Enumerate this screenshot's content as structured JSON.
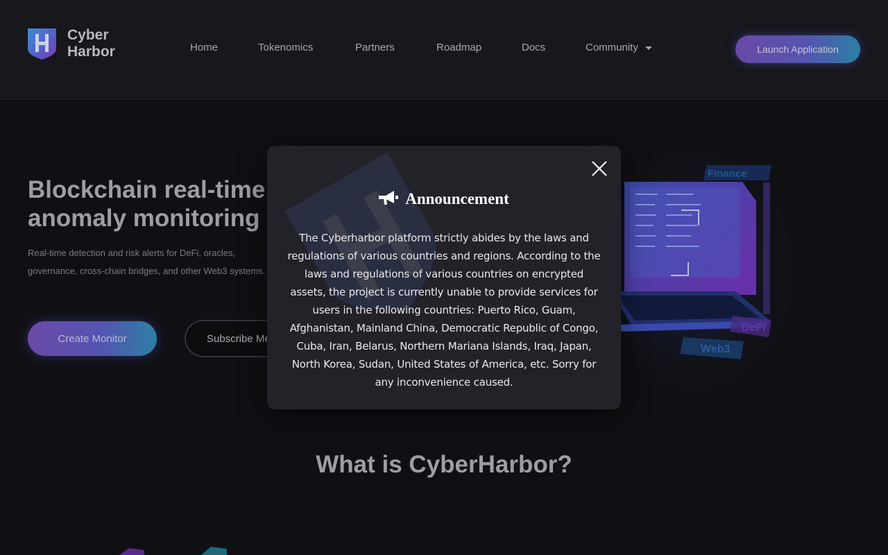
{
  "brand": {
    "name": "Cyber\nHarbor",
    "logo_letter": "H"
  },
  "nav": {
    "items": [
      {
        "label": "Home"
      },
      {
        "label": "Tokenomics"
      },
      {
        "label": "Partners"
      },
      {
        "label": "Roadmap"
      },
      {
        "label": "Docs"
      },
      {
        "label": "Community"
      }
    ],
    "launch_label": "Launch Application"
  },
  "hero": {
    "title": "Blockchain real-time on-chain anomaly monitoring",
    "subtitle": "Real-time detection and risk alerts for DeFi, oracles, governance, cross-chain bridges, and other Web3 systems.",
    "create_label": "Create Monitor",
    "subscribe_label": "Subscribe Me",
    "art_tags": [
      "Finance",
      "DeFi",
      "Web3"
    ]
  },
  "section": {
    "title": "What is CyberHarbor?"
  },
  "modal": {
    "title": "Announcement",
    "body": "The Cyberharbor platform strictly abides by the laws and regulations of various countries and regions. According to the laws and regulations of various countries on encrypted assets, the project is currently unable to provide services for users in the following countries: Puerto Rico, Guam, Afghanistan, Mainland China, Democratic Republic of Congo, Cuba, Iran, Belarus, Northern Mariana Islands, Iraq, Japan, North Korea, Sudan, United States of America, etc. Sorry for any inconvenience caused."
  },
  "colors": {
    "background": "#101014",
    "header": "#17171c",
    "modal": "#222228",
    "accent_purple": "#6a4aa7",
    "accent_teal": "#2c7fa6"
  }
}
